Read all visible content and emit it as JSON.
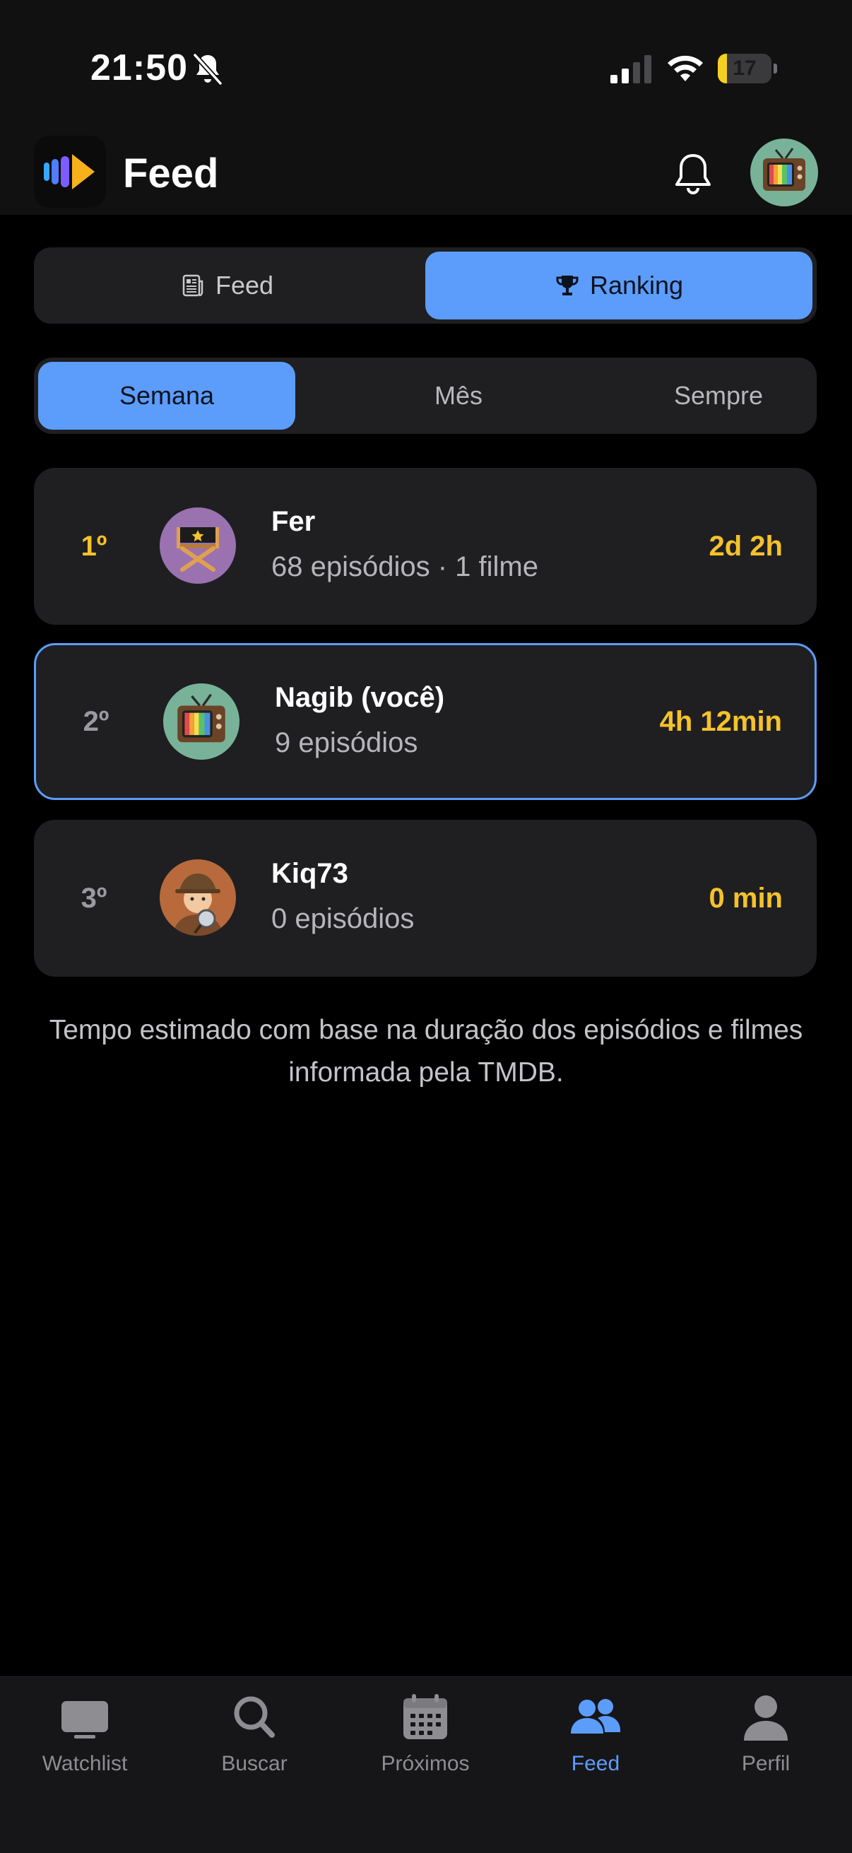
{
  "status_bar": {
    "time": "21:50",
    "battery": "17",
    "battery_level": 0.17
  },
  "header": {
    "title": "Feed"
  },
  "main_tabs": {
    "feed_label": "Feed",
    "ranking_label": "Ranking",
    "active": "Ranking"
  },
  "period_tabs": {
    "week": "Semana",
    "month": "Mês",
    "always": "Sempre",
    "active": "Semana"
  },
  "ranking": [
    {
      "position": "1º",
      "name": "Fer",
      "stats": "68 episódios · 1 filme",
      "time": "2d 2h",
      "avatar": "director-chair-icon"
    },
    {
      "position": "2º",
      "name": "Nagib (você)",
      "stats": "9 episódios",
      "time": "4h 12min",
      "avatar": "retro-tv-icon"
    },
    {
      "position": "3º",
      "name": "Kiq73",
      "stats": "0 episódios",
      "time": "0 min",
      "avatar": "detective-icon"
    }
  ],
  "footnote": "Tempo estimado com base na duração dos episódios e filmes informada pela TMDB.",
  "nav": {
    "watchlist": "Watchlist",
    "buscar": "Buscar",
    "proximos": "Próximos",
    "feed": "Feed",
    "perfil": "Perfil",
    "active": "Feed"
  },
  "colors": {
    "accent": "#5c9dfb",
    "gold": "#f5c22a",
    "card": "#1f1f22",
    "background": "#000000"
  }
}
